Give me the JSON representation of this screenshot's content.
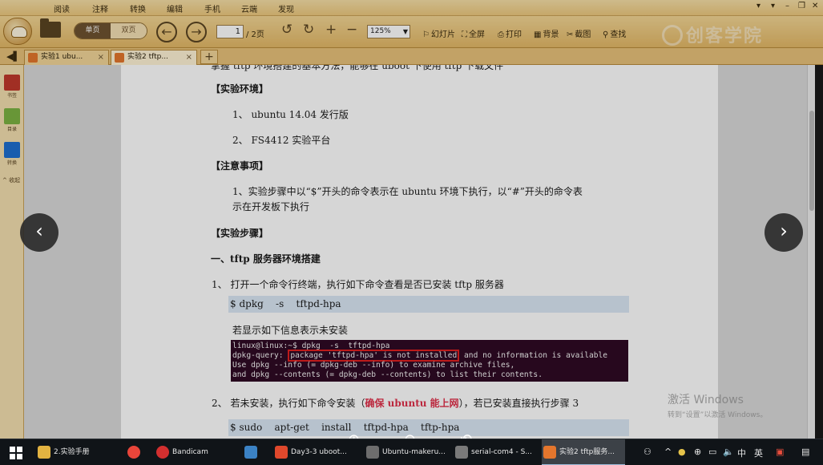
{
  "menu": [
    "阅读",
    "注释",
    "转换",
    "编辑",
    "手机",
    "云端",
    "发现"
  ],
  "window_controls": [
    "▾",
    "▾",
    "–",
    "❐",
    "✕"
  ],
  "toolbar": {
    "view_single": "单页",
    "view_double": "双页",
    "page_current": "1",
    "page_total": "/ 2页",
    "zoom": "125%",
    "slideshow": "幻灯片",
    "fullscreen": "全屏",
    "print": "打印",
    "background": "背景",
    "screenshot": "截图",
    "find": "查找",
    "brand_watermark": "创客学院"
  },
  "tabs": [
    {
      "label": "实验1 ubu...",
      "active": false
    },
    {
      "label": "实验2 tftp...",
      "active": true
    }
  ],
  "sidebar": {
    "items": [
      {
        "label": "书签",
        "icon": "bookmark-icon",
        "color": "#c0392b"
      },
      {
        "label": "目录",
        "icon": "outline-icon",
        "color": "#7cb342"
      },
      {
        "label": "转换",
        "icon": "convert-icon",
        "color": "#1e6fd0"
      }
    ],
    "collapse": "^ 收起"
  },
  "document": {
    "intro_cut": "掌握 tftp 环境搭建的基本方法，能够在 uboot 下使用 tftp 下载文件",
    "env_heading": "【实验环境】",
    "env_1": "1、 ubuntu 14.04 发行版",
    "env_2": "2、 FS4412 实验平台",
    "note_heading": "【注意事项】",
    "note_1a": "1、实验步骤中以“$”开头的命令表示在  ubuntu  环境下执行，以“#”开头的命令表",
    "note_1b": "示在开发板下执行",
    "steps_heading": "【实验步骤】",
    "section_1": "一、tftp 服务器环境搭建",
    "step_1": "1、    打开一个命令行终端，执行如下命令查看是否已安装 tftp 服务器",
    "cmd_1": "$ dpkg    -s    tftpd-hpa",
    "if_not": "若显示如下信息表示未安装",
    "terminal": {
      "l1": "linux@linux:~$ dpkg  -s  tftpd-hpa",
      "l2a": "dpkg-query: ",
      "l2b": "package 'tftpd-hpa' is not installed",
      "l2c": " and no information is available",
      "l3": "Use dpkg --info (= dpkg-deb --info) to examine archive files,",
      "l4": "and dpkg --contents (= dpkg-deb --contents) to list their contents."
    },
    "step_2_a": "2、    若未安装，执行如下命令安装（",
    "step_2_b": "确保 ubuntu 能上网",
    "step_2_c": "），若已安装直接执行步骤 3",
    "cmd_2": "$ sudo    apt-get    install    tftpd-hpa    tftp-hpa"
  },
  "viewer": {
    "prev": "‹",
    "next": "›",
    "zoom_in": "⊕",
    "zoom_out": "⊖",
    "rotate": "⟲"
  },
  "activate_windows": {
    "title": "激活 Windows",
    "subtitle": "转到“设置”以激活 Windows。"
  },
  "taskbar": {
    "items": [
      {
        "label": "2.实验手册",
        "color": "#e3b341"
      },
      {
        "label": "",
        "color": "#e9453a"
      },
      {
        "label": "Bandicam",
        "color": "#d32f2f"
      },
      {
        "label": "",
        "color": "#3b82c4"
      },
      {
        "label": "Day3-3 uboot...",
        "color": "#e0482c"
      },
      {
        "label": "Ubuntu-makeru...",
        "color": "#6d6d6d"
      },
      {
        "label": "serial-com4 - S...",
        "color": "#7a7a7a"
      },
      {
        "label": "实验2 tftp服务...",
        "color": "#e4762d"
      }
    ],
    "tray": {
      "ime": "中",
      "lang": "英",
      "caret": "^"
    }
  }
}
